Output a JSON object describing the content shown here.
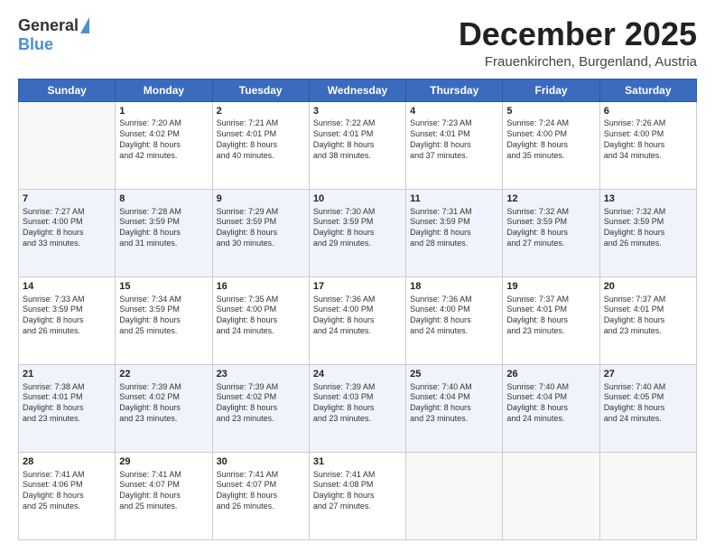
{
  "logo": {
    "general": "General",
    "blue": "Blue"
  },
  "header": {
    "month": "December 2025",
    "location": "Frauenkirchen, Burgenland, Austria"
  },
  "days_of_week": [
    "Sunday",
    "Monday",
    "Tuesday",
    "Wednesday",
    "Thursday",
    "Friday",
    "Saturday"
  ],
  "weeks": [
    [
      {
        "day": "",
        "info": ""
      },
      {
        "day": "1",
        "info": "Sunrise: 7:20 AM\nSunset: 4:02 PM\nDaylight: 8 hours\nand 42 minutes."
      },
      {
        "day": "2",
        "info": "Sunrise: 7:21 AM\nSunset: 4:01 PM\nDaylight: 8 hours\nand 40 minutes."
      },
      {
        "day": "3",
        "info": "Sunrise: 7:22 AM\nSunset: 4:01 PM\nDaylight: 8 hours\nand 38 minutes."
      },
      {
        "day": "4",
        "info": "Sunrise: 7:23 AM\nSunset: 4:01 PM\nDaylight: 8 hours\nand 37 minutes."
      },
      {
        "day": "5",
        "info": "Sunrise: 7:24 AM\nSunset: 4:00 PM\nDaylight: 8 hours\nand 35 minutes."
      },
      {
        "day": "6",
        "info": "Sunrise: 7:26 AM\nSunset: 4:00 PM\nDaylight: 8 hours\nand 34 minutes."
      }
    ],
    [
      {
        "day": "7",
        "info": "Sunrise: 7:27 AM\nSunset: 4:00 PM\nDaylight: 8 hours\nand 33 minutes."
      },
      {
        "day": "8",
        "info": "Sunrise: 7:28 AM\nSunset: 3:59 PM\nDaylight: 8 hours\nand 31 minutes."
      },
      {
        "day": "9",
        "info": "Sunrise: 7:29 AM\nSunset: 3:59 PM\nDaylight: 8 hours\nand 30 minutes."
      },
      {
        "day": "10",
        "info": "Sunrise: 7:30 AM\nSunset: 3:59 PM\nDaylight: 8 hours\nand 29 minutes."
      },
      {
        "day": "11",
        "info": "Sunrise: 7:31 AM\nSunset: 3:59 PM\nDaylight: 8 hours\nand 28 minutes."
      },
      {
        "day": "12",
        "info": "Sunrise: 7:32 AM\nSunset: 3:59 PM\nDaylight: 8 hours\nand 27 minutes."
      },
      {
        "day": "13",
        "info": "Sunrise: 7:32 AM\nSunset: 3:59 PM\nDaylight: 8 hours\nand 26 minutes."
      }
    ],
    [
      {
        "day": "14",
        "info": "Sunrise: 7:33 AM\nSunset: 3:59 PM\nDaylight: 8 hours\nand 26 minutes."
      },
      {
        "day": "15",
        "info": "Sunrise: 7:34 AM\nSunset: 3:59 PM\nDaylight: 8 hours\nand 25 minutes."
      },
      {
        "day": "16",
        "info": "Sunrise: 7:35 AM\nSunset: 4:00 PM\nDaylight: 8 hours\nand 24 minutes."
      },
      {
        "day": "17",
        "info": "Sunrise: 7:36 AM\nSunset: 4:00 PM\nDaylight: 8 hours\nand 24 minutes."
      },
      {
        "day": "18",
        "info": "Sunrise: 7:36 AM\nSunset: 4:00 PM\nDaylight: 8 hours\nand 24 minutes."
      },
      {
        "day": "19",
        "info": "Sunrise: 7:37 AM\nSunset: 4:01 PM\nDaylight: 8 hours\nand 23 minutes."
      },
      {
        "day": "20",
        "info": "Sunrise: 7:37 AM\nSunset: 4:01 PM\nDaylight: 8 hours\nand 23 minutes."
      }
    ],
    [
      {
        "day": "21",
        "info": "Sunrise: 7:38 AM\nSunset: 4:01 PM\nDaylight: 8 hours\nand 23 minutes."
      },
      {
        "day": "22",
        "info": "Sunrise: 7:39 AM\nSunset: 4:02 PM\nDaylight: 8 hours\nand 23 minutes."
      },
      {
        "day": "23",
        "info": "Sunrise: 7:39 AM\nSunset: 4:02 PM\nDaylight: 8 hours\nand 23 minutes."
      },
      {
        "day": "24",
        "info": "Sunrise: 7:39 AM\nSunset: 4:03 PM\nDaylight: 8 hours\nand 23 minutes."
      },
      {
        "day": "25",
        "info": "Sunrise: 7:40 AM\nSunset: 4:04 PM\nDaylight: 8 hours\nand 23 minutes."
      },
      {
        "day": "26",
        "info": "Sunrise: 7:40 AM\nSunset: 4:04 PM\nDaylight: 8 hours\nand 24 minutes."
      },
      {
        "day": "27",
        "info": "Sunrise: 7:40 AM\nSunset: 4:05 PM\nDaylight: 8 hours\nand 24 minutes."
      }
    ],
    [
      {
        "day": "28",
        "info": "Sunrise: 7:41 AM\nSunset: 4:06 PM\nDaylight: 8 hours\nand 25 minutes."
      },
      {
        "day": "29",
        "info": "Sunrise: 7:41 AM\nSunset: 4:07 PM\nDaylight: 8 hours\nand 25 minutes."
      },
      {
        "day": "30",
        "info": "Sunrise: 7:41 AM\nSunset: 4:07 PM\nDaylight: 8 hours\nand 26 minutes."
      },
      {
        "day": "31",
        "info": "Sunrise: 7:41 AM\nSunset: 4:08 PM\nDaylight: 8 hours\nand 27 minutes."
      },
      {
        "day": "",
        "info": ""
      },
      {
        "day": "",
        "info": ""
      },
      {
        "day": "",
        "info": ""
      }
    ]
  ]
}
